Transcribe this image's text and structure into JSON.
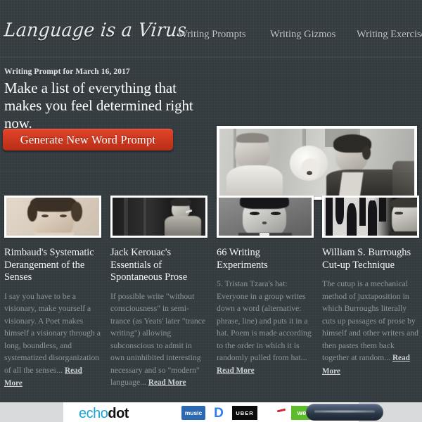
{
  "site": {
    "logo": "Language is a Virus",
    "nav": [
      {
        "label": "Writing Prompts"
      },
      {
        "label": "Writing Gizmos"
      },
      {
        "label": "Writing Exercises"
      }
    ]
  },
  "hero": {
    "prompt_label": "Writing Prompt for March 16, 2017",
    "prompt_headline": "Make a list of everything that makes you feel determined right now.",
    "generate_button": "Generate New Word Prompt",
    "photo_alt": "Gertrude Stein with poodle and Alice B. Toklas",
    "button_color": "#d03a20"
  },
  "cards": [
    {
      "title": "Rimbaud's Systematic Derangement of the Senses",
      "body": "I say you have to be a visionary, make yourself a visionary. A Poet makes himself a visionary through a long, boundless, and systematized disorganization of all the senses...",
      "read_more": "Read More",
      "image_alt": "Portrait of Arthur Rimbaud"
    },
    {
      "title": "Jack Kerouac's Essentials of Spontaneous Prose",
      "body": "If possible write \"without consciousness\" in semi-trance (as Yeats' later \"trance writing\") allowing subconscious to admit in own uninhibited interesting necessary and so \"modern\" language...",
      "read_more": "Read More",
      "image_alt": "Portrait of Jack Kerouac smoking"
    },
    {
      "title": "66 Writing Experiments",
      "body": "5. Tristan Tzara's hat: Everyone in a group writes down a word (alternative: phrase, line) and puts it in a hat. Poem is made according to the order in which it is randomly pulled from hat...",
      "read_more": "Read More",
      "image_alt": "Portrait of Tristan Tzara"
    },
    {
      "title": "William S. Burroughs Cut-up Technique",
      "body": "The cutup is a mechanical method of juxtaposition in which Burroughs literally cuts up passages of prose by himself and other writers and then pastes them back together at random...",
      "read_more": "Read More",
      "image_alt": "Portrait of William S. Burroughs"
    }
  ],
  "ad": {
    "brand_prefix": "echo",
    "brand_suffix": "dot",
    "logos": [
      {
        "label": "music"
      },
      {
        "label": "D"
      },
      {
        "label": "UBER"
      },
      {
        "label": "CapitalOne"
      },
      {
        "label": "we"
      }
    ]
  },
  "theme": {
    "background": "#343c40",
    "text": "#f2f4f5",
    "muted": "#8d969b",
    "accent": "#d03a20"
  }
}
